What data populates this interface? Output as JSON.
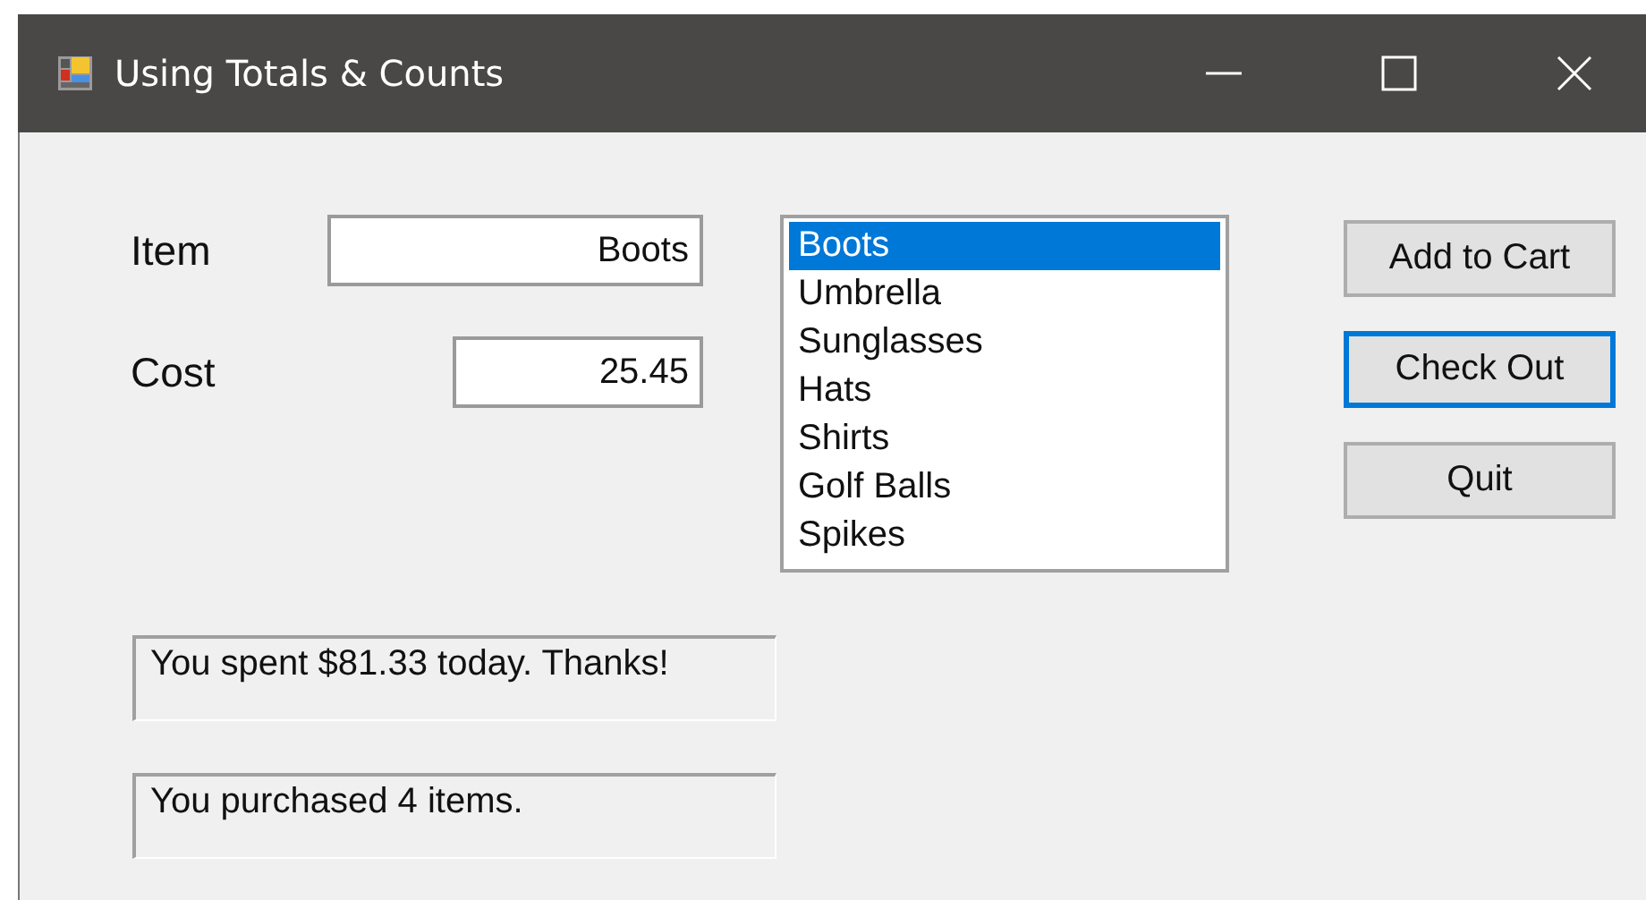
{
  "window": {
    "title": "Using Totals & Counts"
  },
  "fields": [
    {
      "label": "Item",
      "value": "Boots"
    },
    {
      "label": "Cost",
      "value": "25.45"
    }
  ],
  "listbox": {
    "items": [
      {
        "text": "Boots",
        "selected": true
      },
      {
        "text": "Umbrella",
        "selected": false
      },
      {
        "text": "Sunglasses",
        "selected": false
      },
      {
        "text": "Hats",
        "selected": false
      },
      {
        "text": "Shirts",
        "selected": false
      },
      {
        "text": "Golf Balls",
        "selected": false
      },
      {
        "text": "Spikes",
        "selected": false
      }
    ]
  },
  "buttons": [
    {
      "label": "Add to Cart",
      "focused": false
    },
    {
      "label": "Check Out",
      "focused": true
    },
    {
      "label": "Quit",
      "focused": false
    }
  ],
  "outputs": [
    "You spent $81.33 today. Thanks!",
    "You purchased 4 items."
  ]
}
